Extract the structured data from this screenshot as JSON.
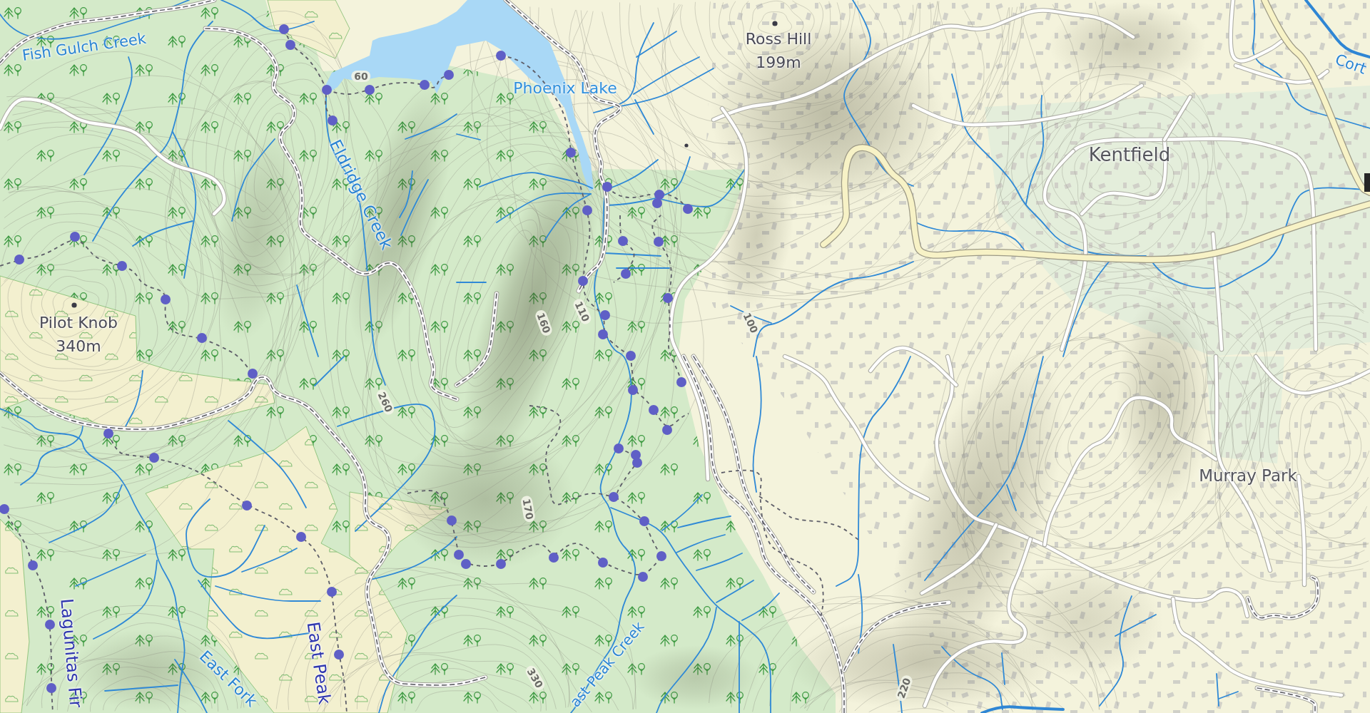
{
  "map": {
    "waterway_labels": [
      {
        "kind": "creek",
        "text": "Fish Gulch Creek"
      },
      {
        "kind": "lake",
        "text": "Phoenix Lake"
      },
      {
        "kind": "creek",
        "text": "Eldridge Creek"
      },
      {
        "kind": "creek",
        "text": "Cort"
      },
      {
        "kind": "creek",
        "text": "East Fork"
      },
      {
        "kind": "creek",
        "text": "ast Peak Creek"
      }
    ],
    "places": [
      {
        "kind": "peak",
        "name": "Ross Hill",
        "elevation": "199m"
      },
      {
        "kind": "town",
        "name": "Kentfield"
      },
      {
        "kind": "peak",
        "name": "Pilot Knob",
        "elevation": "340m"
      },
      {
        "kind": "town",
        "name": "Murray Park"
      }
    ],
    "trail_labels": [
      "Lagunitas Fir",
      "East Peak"
    ],
    "contour_labels": [
      "60",
      "110",
      "160",
      "100",
      "260",
      "170",
      "330",
      "220"
    ]
  }
}
